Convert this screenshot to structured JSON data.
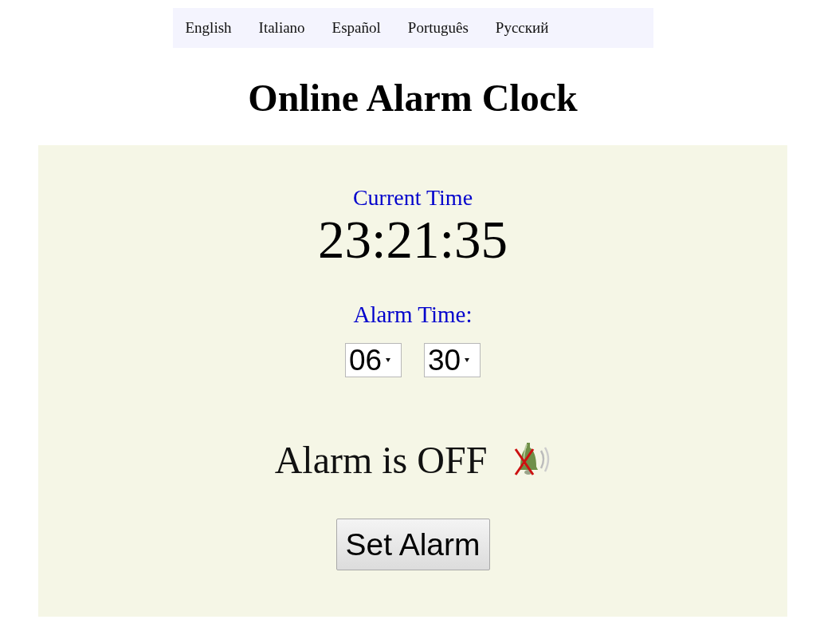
{
  "language_nav": [
    {
      "label": "English"
    },
    {
      "label": "Italiano"
    },
    {
      "label": "Español"
    },
    {
      "label": "Português"
    },
    {
      "label": "Русский"
    }
  ],
  "title": "Online Alarm Clock",
  "current_time": {
    "label": "Current Time",
    "value": "23:21:35"
  },
  "alarm_time": {
    "label": "Alarm Time:",
    "hour": "06",
    "minute": "30"
  },
  "alarm_status": {
    "text": "Alarm is OFF",
    "on": false
  },
  "set_button": "Set Alarm"
}
